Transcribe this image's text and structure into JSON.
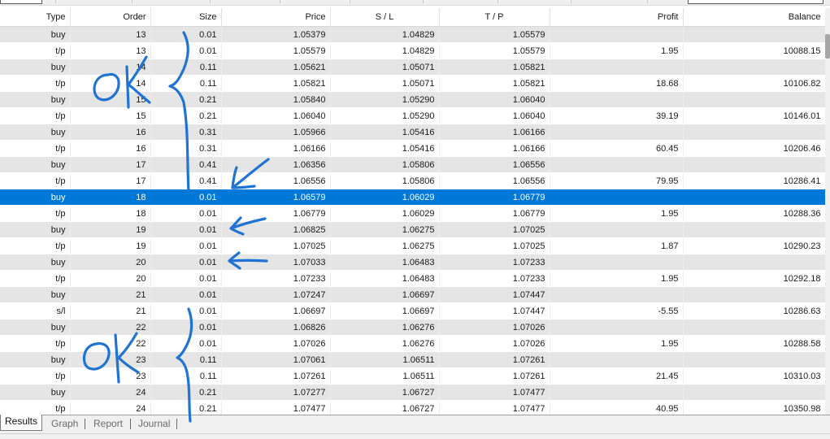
{
  "columns": [
    {
      "key": "type",
      "label": "Type"
    },
    {
      "key": "order",
      "label": "Order"
    },
    {
      "key": "size",
      "label": "Size"
    },
    {
      "key": "price",
      "label": "Price"
    },
    {
      "key": "sl",
      "label": "S / L"
    },
    {
      "key": "tp",
      "label": "T / P"
    },
    {
      "key": "profit",
      "label": "Profit"
    },
    {
      "key": "balance",
      "label": "Balance"
    }
  ],
  "rows": [
    [
      "buy",
      "13",
      "0.01",
      "1.05379",
      "1.04829",
      "1.05579",
      "",
      ""
    ],
    [
      "t/p",
      "13",
      "0.01",
      "1.05579",
      "1.04829",
      "1.05579",
      "1.95",
      "10088.15"
    ],
    [
      "buy",
      "14",
      "0.11",
      "1.05621",
      "1.05071",
      "1.05821",
      "",
      ""
    ],
    [
      "t/p",
      "14",
      "0.11",
      "1.05821",
      "1.05071",
      "1.05821",
      "18.68",
      "10106.82"
    ],
    [
      "buy",
      "15",
      "0.21",
      "1.05840",
      "1.05290",
      "1.06040",
      "",
      ""
    ],
    [
      "t/p",
      "15",
      "0.21",
      "1.06040",
      "1.05290",
      "1.06040",
      "39.19",
      "10146.01"
    ],
    [
      "buy",
      "16",
      "0.31",
      "1.05966",
      "1.05416",
      "1.06166",
      "",
      ""
    ],
    [
      "t/p",
      "16",
      "0.31",
      "1.06166",
      "1.05416",
      "1.06166",
      "60.45",
      "10206.46"
    ],
    [
      "buy",
      "17",
      "0.41",
      "1.06356",
      "1.05806",
      "1.06556",
      "",
      ""
    ],
    [
      "t/p",
      "17",
      "0.41",
      "1.06556",
      "1.05806",
      "1.06556",
      "79.95",
      "10286.41"
    ],
    [
      "buy",
      "18",
      "0.01",
      "1.06579",
      "1.06029",
      "1.06779",
      "",
      ""
    ],
    [
      "t/p",
      "18",
      "0.01",
      "1.06779",
      "1.06029",
      "1.06779",
      "1.95",
      "10288.36"
    ],
    [
      "buy",
      "19",
      "0.01",
      "1.06825",
      "1.06275",
      "1.07025",
      "",
      ""
    ],
    [
      "t/p",
      "19",
      "0.01",
      "1.07025",
      "1.06275",
      "1.07025",
      "1.87",
      "10290.23"
    ],
    [
      "buy",
      "20",
      "0.01",
      "1.07033",
      "1.06483",
      "1.07233",
      "",
      ""
    ],
    [
      "t/p",
      "20",
      "0.01",
      "1.07233",
      "1.06483",
      "1.07233",
      "1.95",
      "10292.18"
    ],
    [
      "buy",
      "21",
      "0.01",
      "1.07247",
      "1.06697",
      "1.07447",
      "",
      ""
    ],
    [
      "s/l",
      "21",
      "0.01",
      "1.06697",
      "1.06697",
      "1.07447",
      "-5.55",
      "10286.63"
    ],
    [
      "buy",
      "22",
      "0.01",
      "1.06826",
      "1.06276",
      "1.07026",
      "",
      ""
    ],
    [
      "t/p",
      "22",
      "0.01",
      "1.07026",
      "1.06276",
      "1.07026",
      "1.95",
      "10288.58"
    ],
    [
      "buy",
      "23",
      "0.11",
      "1.07061",
      "1.06511",
      "1.07261",
      "",
      ""
    ],
    [
      "t/p",
      "23",
      "0.11",
      "1.07261",
      "1.06511",
      "1.07261",
      "21.45",
      "10310.03"
    ],
    [
      "buy",
      "24",
      "0.21",
      "1.07277",
      "1.06727",
      "1.07477",
      "",
      ""
    ],
    [
      "t/p",
      "24",
      "0.21",
      "1.07477",
      "1.06727",
      "1.07477",
      "40.95",
      "10350.98"
    ]
  ],
  "selected_row_index": 10,
  "tabs": [
    {
      "label": "Results",
      "active": true
    },
    {
      "label": "Graph",
      "active": false
    },
    {
      "label": "Report",
      "active": false
    },
    {
      "label": "Journal",
      "active": false
    }
  ],
  "annotations": {
    "ok_upper": "OK",
    "ok_lower": "OK",
    "ink_color": "#1f73d3"
  },
  "colors": {
    "selection": "#0078d7",
    "zebra": "#e5e5e5"
  }
}
